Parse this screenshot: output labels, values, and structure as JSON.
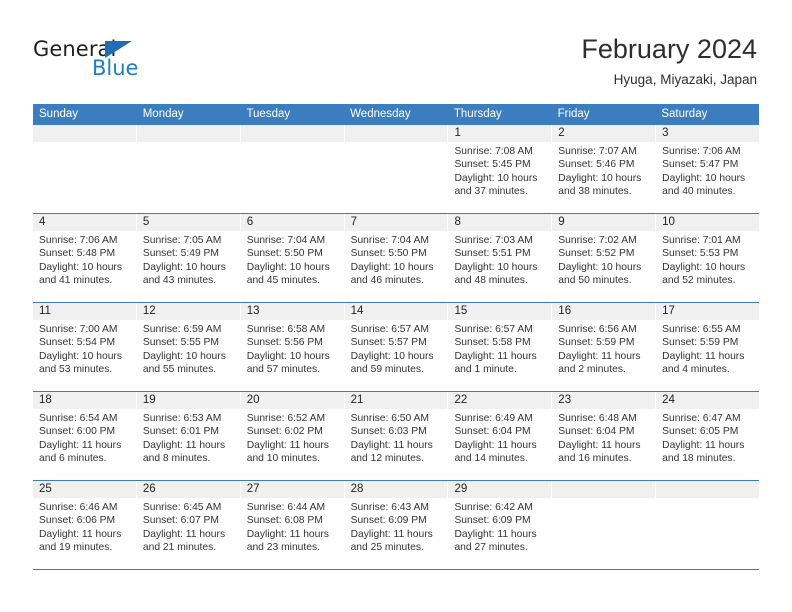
{
  "brand": {
    "name_top": "General",
    "name_bottom": "Blue",
    "triangle_color": "#1f6eb5",
    "blue_text_color": "#1f7ec4"
  },
  "header": {
    "title": "February 2024",
    "subtitle": "Hyuga, Miyazaki, Japan"
  },
  "colors": {
    "header_blue": "#3b7dbf",
    "day_band_gray": "#f0f0f0",
    "text": "#231f20"
  },
  "weekday_headers": [
    "Sunday",
    "Monday",
    "Tuesday",
    "Wednesday",
    "Thursday",
    "Friday",
    "Saturday"
  ],
  "weeks": [
    [
      {
        "day": "",
        "lines": []
      },
      {
        "day": "",
        "lines": []
      },
      {
        "day": "",
        "lines": []
      },
      {
        "day": "",
        "lines": []
      },
      {
        "day": "1",
        "lines": [
          "Sunrise: 7:08 AM",
          "Sunset: 5:45 PM",
          "Daylight: 10 hours",
          "and 37 minutes."
        ]
      },
      {
        "day": "2",
        "lines": [
          "Sunrise: 7:07 AM",
          "Sunset: 5:46 PM",
          "Daylight: 10 hours",
          "and 38 minutes."
        ]
      },
      {
        "day": "3",
        "lines": [
          "Sunrise: 7:06 AM",
          "Sunset: 5:47 PM",
          "Daylight: 10 hours",
          "and 40 minutes."
        ]
      }
    ],
    [
      {
        "day": "4",
        "lines": [
          "Sunrise: 7:06 AM",
          "Sunset: 5:48 PM",
          "Daylight: 10 hours",
          "and 41 minutes."
        ]
      },
      {
        "day": "5",
        "lines": [
          "Sunrise: 7:05 AM",
          "Sunset: 5:49 PM",
          "Daylight: 10 hours",
          "and 43 minutes."
        ]
      },
      {
        "day": "6",
        "lines": [
          "Sunrise: 7:04 AM",
          "Sunset: 5:50 PM",
          "Daylight: 10 hours",
          "and 45 minutes."
        ]
      },
      {
        "day": "7",
        "lines": [
          "Sunrise: 7:04 AM",
          "Sunset: 5:50 PM",
          "Daylight: 10 hours",
          "and 46 minutes."
        ]
      },
      {
        "day": "8",
        "lines": [
          "Sunrise: 7:03 AM",
          "Sunset: 5:51 PM",
          "Daylight: 10 hours",
          "and 48 minutes."
        ]
      },
      {
        "day": "9",
        "lines": [
          "Sunrise: 7:02 AM",
          "Sunset: 5:52 PM",
          "Daylight: 10 hours",
          "and 50 minutes."
        ]
      },
      {
        "day": "10",
        "lines": [
          "Sunrise: 7:01 AM",
          "Sunset: 5:53 PM",
          "Daylight: 10 hours",
          "and 52 minutes."
        ]
      }
    ],
    [
      {
        "day": "11",
        "lines": [
          "Sunrise: 7:00 AM",
          "Sunset: 5:54 PM",
          "Daylight: 10 hours",
          "and 53 minutes."
        ]
      },
      {
        "day": "12",
        "lines": [
          "Sunrise: 6:59 AM",
          "Sunset: 5:55 PM",
          "Daylight: 10 hours",
          "and 55 minutes."
        ]
      },
      {
        "day": "13",
        "lines": [
          "Sunrise: 6:58 AM",
          "Sunset: 5:56 PM",
          "Daylight: 10 hours",
          "and 57 minutes."
        ]
      },
      {
        "day": "14",
        "lines": [
          "Sunrise: 6:57 AM",
          "Sunset: 5:57 PM",
          "Daylight: 10 hours",
          "and 59 minutes."
        ]
      },
      {
        "day": "15",
        "lines": [
          "Sunrise: 6:57 AM",
          "Sunset: 5:58 PM",
          "Daylight: 11 hours",
          "and 1 minute."
        ]
      },
      {
        "day": "16",
        "lines": [
          "Sunrise: 6:56 AM",
          "Sunset: 5:59 PM",
          "Daylight: 11 hours",
          "and 2 minutes."
        ]
      },
      {
        "day": "17",
        "lines": [
          "Sunrise: 6:55 AM",
          "Sunset: 5:59 PM",
          "Daylight: 11 hours",
          "and 4 minutes."
        ]
      }
    ],
    [
      {
        "day": "18",
        "lines": [
          "Sunrise: 6:54 AM",
          "Sunset: 6:00 PM",
          "Daylight: 11 hours",
          "and 6 minutes."
        ]
      },
      {
        "day": "19",
        "lines": [
          "Sunrise: 6:53 AM",
          "Sunset: 6:01 PM",
          "Daylight: 11 hours",
          "and 8 minutes."
        ]
      },
      {
        "day": "20",
        "lines": [
          "Sunrise: 6:52 AM",
          "Sunset: 6:02 PM",
          "Daylight: 11 hours",
          "and 10 minutes."
        ]
      },
      {
        "day": "21",
        "lines": [
          "Sunrise: 6:50 AM",
          "Sunset: 6:03 PM",
          "Daylight: 11 hours",
          "and 12 minutes."
        ]
      },
      {
        "day": "22",
        "lines": [
          "Sunrise: 6:49 AM",
          "Sunset: 6:04 PM",
          "Daylight: 11 hours",
          "and 14 minutes."
        ]
      },
      {
        "day": "23",
        "lines": [
          "Sunrise: 6:48 AM",
          "Sunset: 6:04 PM",
          "Daylight: 11 hours",
          "and 16 minutes."
        ]
      },
      {
        "day": "24",
        "lines": [
          "Sunrise: 6:47 AM",
          "Sunset: 6:05 PM",
          "Daylight: 11 hours",
          "and 18 minutes."
        ]
      }
    ],
    [
      {
        "day": "25",
        "lines": [
          "Sunrise: 6:46 AM",
          "Sunset: 6:06 PM",
          "Daylight: 11 hours",
          "and 19 minutes."
        ]
      },
      {
        "day": "26",
        "lines": [
          "Sunrise: 6:45 AM",
          "Sunset: 6:07 PM",
          "Daylight: 11 hours",
          "and 21 minutes."
        ]
      },
      {
        "day": "27",
        "lines": [
          "Sunrise: 6:44 AM",
          "Sunset: 6:08 PM",
          "Daylight: 11 hours",
          "and 23 minutes."
        ]
      },
      {
        "day": "28",
        "lines": [
          "Sunrise: 6:43 AM",
          "Sunset: 6:09 PM",
          "Daylight: 11 hours",
          "and 25 minutes."
        ]
      },
      {
        "day": "29",
        "lines": [
          "Sunrise: 6:42 AM",
          "Sunset: 6:09 PM",
          "Daylight: 11 hours",
          "and 27 minutes."
        ]
      },
      {
        "day": "",
        "lines": []
      },
      {
        "day": "",
        "lines": []
      }
    ]
  ]
}
